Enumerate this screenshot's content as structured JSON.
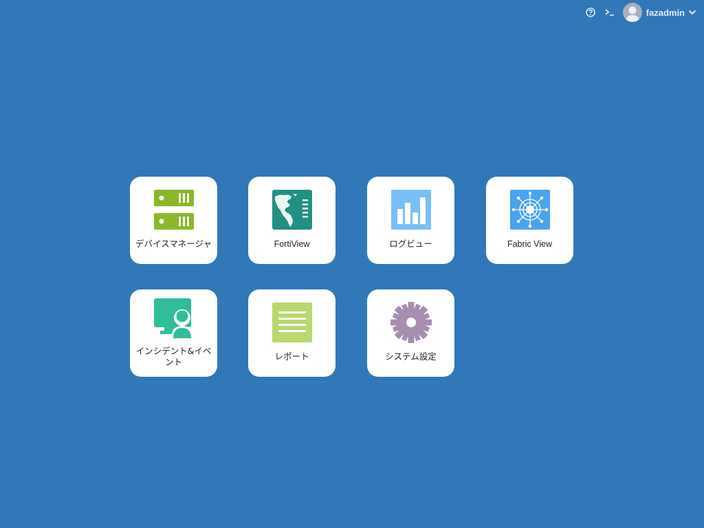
{
  "header": {
    "help_icon": "help-circle-icon",
    "cli_icon": "terminal-icon",
    "username": "fazadmin",
    "dropdown_icon": "chevron-down-icon"
  },
  "tiles": [
    {
      "label": "デバイスマネージャ",
      "icon": "server-icon",
      "color": "#8ab829"
    },
    {
      "label": "FortiView",
      "icon": "world-map-icon",
      "color": "#229082"
    },
    {
      "label": "ログビュー",
      "icon": "bar-chart-icon",
      "color": "#6fb8f5"
    },
    {
      "label": "Fabric View",
      "icon": "fabric-network-icon",
      "color": "#5aa9f0"
    },
    {
      "label": "インシデント&イベント",
      "icon": "monitor-user-icon",
      "color": "#2fbe9a"
    },
    {
      "label": "レポート",
      "icon": "document-lines-icon",
      "color": "#b9d86d"
    },
    {
      "label": "システム設定",
      "icon": "gear-icon",
      "color": "#a78db0"
    }
  ]
}
